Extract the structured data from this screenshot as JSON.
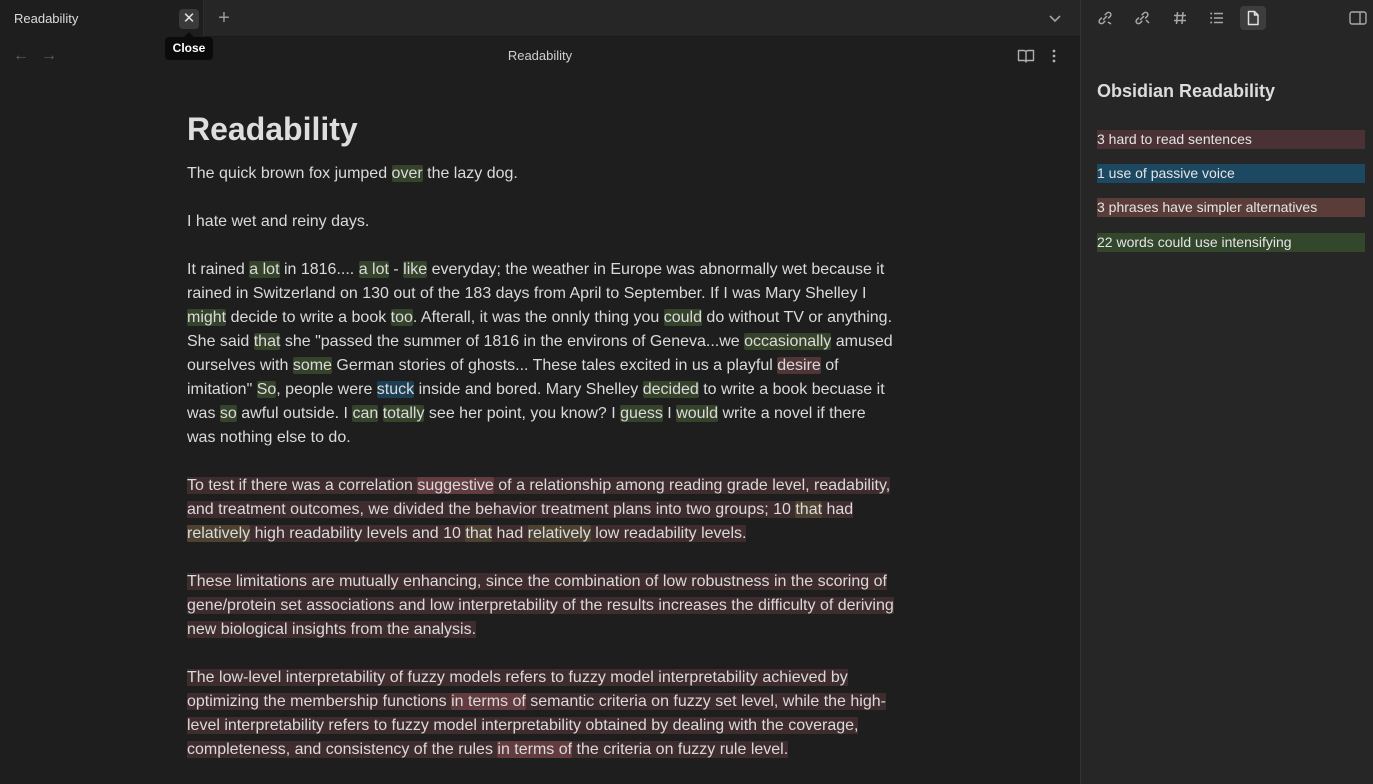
{
  "tab": {
    "title": "Readability",
    "close_tooltip": "Close"
  },
  "view_header": {
    "title": "Readability"
  },
  "document": {
    "title": "Readability",
    "p1": {
      "a": "The quick brown fox jumped ",
      "b": "over",
      "c": " the lazy dog."
    },
    "p2": "I hate wet and reiny days.",
    "p3": [
      {
        "t": "It rained ",
        "c": ""
      },
      {
        "t": "a lot",
        "c": "g"
      },
      {
        "t": " in 1816.... ",
        "c": ""
      },
      {
        "t": "a lot",
        "c": "g"
      },
      {
        "t": " - ",
        "c": ""
      },
      {
        "t": "like",
        "c": "g"
      },
      {
        "t": " everyday; the weather in Europe was abnormally wet because it rained in Switzerland on 130 out of the 183 days from April to September. If I was Mary Shelley I ",
        "c": ""
      },
      {
        "t": "might",
        "c": "g"
      },
      {
        "t": " decide to write a book ",
        "c": ""
      },
      {
        "t": "too",
        "c": "g"
      },
      {
        "t": ". Afterall, it was the onnly thing you ",
        "c": ""
      },
      {
        "t": "could",
        "c": "g"
      },
      {
        "t": " do without TV or anything. She said ",
        "c": ""
      },
      {
        "t": "that",
        "c": "g"
      },
      {
        "t": " she \"passed the summer of 1816 in the environs of Geneva...we ",
        "c": ""
      },
      {
        "t": "occasionally",
        "c": "g"
      },
      {
        "t": " amused ourselves with ",
        "c": ""
      },
      {
        "t": "some",
        "c": "g"
      },
      {
        "t": " German stories of ghosts... These tales excited in us a playful ",
        "c": ""
      },
      {
        "t": "desire",
        "c": "r"
      },
      {
        "t": " of imitation\"  ",
        "c": ""
      },
      {
        "t": "So",
        "c": "g"
      },
      {
        "t": ", people were ",
        "c": ""
      },
      {
        "t": "stuck",
        "c": "b"
      },
      {
        "t": " inside and bored. Mary Shelley ",
        "c": ""
      },
      {
        "t": "decided",
        "c": "g"
      },
      {
        "t": " to write a book becuase it was ",
        "c": ""
      },
      {
        "t": "so",
        "c": "g"
      },
      {
        "t": " awful outside. I ",
        "c": ""
      },
      {
        "t": "can",
        "c": "g"
      },
      {
        "t": " ",
        "c": ""
      },
      {
        "t": "totally",
        "c": "g"
      },
      {
        "t": " see her point, you know? I ",
        "c": ""
      },
      {
        "t": "guess",
        "c": "g"
      },
      {
        "t": " I ",
        "c": ""
      },
      {
        "t": "would",
        "c": "g"
      },
      {
        "t": " write a novel if there was nothing else to do.",
        "c": ""
      }
    ],
    "p4": [
      {
        "t": "To test if there was a correlation ",
        "c": ""
      },
      {
        "t": "suggestive",
        "c": "p"
      },
      {
        "t": " of a relationship among reading grade level, readability, and treatment outcomes, we divided the behavior treatment plans into two groups; 10 ",
        "c": ""
      },
      {
        "t": "that",
        "c": "gi"
      },
      {
        "t": " had ",
        "c": ""
      },
      {
        "t": "relatively",
        "c": "gi"
      },
      {
        "t": " high readability levels and 10 ",
        "c": ""
      },
      {
        "t": "that",
        "c": "gi"
      },
      {
        "t": " had ",
        "c": ""
      },
      {
        "t": "relatively",
        "c": "gi"
      },
      {
        "t": " low readability levels.",
        "c": ""
      }
    ],
    "p5": "These limitations are mutually enhancing, since the combination of low robustness in the scoring of gene/protein set associations and low interpretability of the results increases the difficulty of deriving new biological insights from the analysis.",
    "p6": [
      {
        "t": "The low-level interpretability of fuzzy models refers to fuzzy model interpretability achieved by optimizing the membership functions ",
        "c": ""
      },
      {
        "t": "in terms of",
        "c": "p"
      },
      {
        "t": " semantic criteria on fuzzy set level, while the high-level interpretability refers to fuzzy model interpretability obtained by dealing with the coverage, completeness, and consistency of the rules ",
        "c": ""
      },
      {
        "t": "in terms of",
        "c": "p"
      },
      {
        "t": " the criteria on fuzzy rule level.",
        "c": ""
      }
    ]
  },
  "sidebar": {
    "title": "Obsidian Readability",
    "items": [
      "3 hard to read sentences",
      "1 use of passive voice",
      "3 phrases have simpler alternatives",
      "22 words could use intensifying"
    ]
  },
  "colors": {
    "intensify": "#34432a",
    "passive": "#1d3f56",
    "simpler": "#503537",
    "hard": "#3f2c2f"
  }
}
